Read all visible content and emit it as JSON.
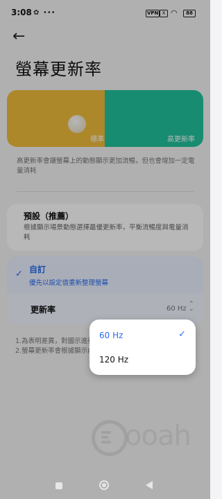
{
  "status_bar": {
    "time": "3:08",
    "vpn": "VPN",
    "x_icon": "X",
    "battery": "88"
  },
  "header": {
    "title": "螢幕更新率"
  },
  "preview": {
    "left_label": "標準",
    "right_label": "高更新率",
    "left_color": "#efbd3c",
    "right_color": "#22c39c"
  },
  "description": "高更新率會讓螢幕上的動態顯示更加流暢，但也會增加一定電量消耗",
  "options": {
    "default": {
      "title": "預設（推薦）",
      "desc": "根據顯示場景動態選擇最優更新率，平衡流暢度與電量消耗"
    },
    "custom": {
      "title": "自訂",
      "desc": "優先以設定值重新整理螢幕"
    }
  },
  "refresh_rate": {
    "label": "更新率",
    "value": "60 Hz"
  },
  "notes": "1.為表明差異，對圖示進行放大處理，實際應用效果為準\n2.螢幕更新率會根據顯示內容動態調整",
  "popup": {
    "options": [
      "60 Hz",
      "120 Hz"
    ],
    "selected": "60 Hz"
  },
  "watermark": {
    "text": "ooah"
  },
  "colors": {
    "accent": "#2a6ef0"
  }
}
